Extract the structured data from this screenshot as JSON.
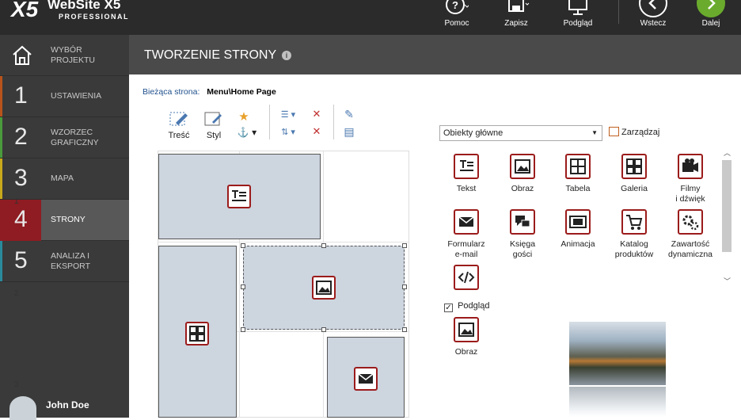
{
  "app": {
    "logo_mark": "X5",
    "name": "WebSite X5",
    "edition": "PROFESSIONAL"
  },
  "toolbar": [
    {
      "label": "Pomoc",
      "icon": "help-icon"
    },
    {
      "label": "Zapisz",
      "icon": "save-icon"
    },
    {
      "label": "Podgląd",
      "icon": "monitor-icon"
    },
    {
      "label": "Wstecz",
      "icon": "back-icon"
    },
    {
      "label": "Dalej",
      "icon": "next-icon"
    }
  ],
  "sidebar": {
    "items": [
      {
        "num": "",
        "label": "WYBÓR PROJEKTU",
        "icon": "home-icon",
        "color": "#3a3a3a"
      },
      {
        "num": "1",
        "label": "USTAWIENIA",
        "color": "#b8541b"
      },
      {
        "num": "2",
        "label": "WZORZEC GRAFICZNY",
        "color": "#4a9a3c"
      },
      {
        "num": "3",
        "label": "MAPA",
        "color": "#c9a91c"
      },
      {
        "num": "4",
        "label": "STRONY",
        "color": "#8e1c22"
      },
      {
        "num": "5",
        "label": "ANALIZA I EKSPORT",
        "color": "#2a8a9c"
      }
    ],
    "active_index": 4,
    "user": "John Doe"
  },
  "header": {
    "title": "TWORZENIE STRONY",
    "info_icon": "info-icon"
  },
  "current_page": {
    "label": "Bieżąca strona:",
    "value": "Menu\\Home Page"
  },
  "edit_tools": {
    "content": "Treść",
    "style": "Styl"
  },
  "grid": {
    "rows": [
      "1",
      "2",
      "3"
    ]
  },
  "objects": {
    "dropdown_value": "Obiekty główne",
    "manage_label": "Zarządzaj",
    "items": [
      {
        "label": "Tekst",
        "icon": "text-icon"
      },
      {
        "label": "Obraz",
        "icon": "image-icon"
      },
      {
        "label": "Tabela",
        "icon": "table-icon"
      },
      {
        "label": "Galeria",
        "icon": "gallery-icon"
      },
      {
        "label": "Filmy\ni dźwięk",
        "icon": "video-icon"
      },
      {
        "label": "Formularz\ne-mail",
        "icon": "email-icon"
      },
      {
        "label": "Księga\ngości",
        "icon": "guestbook-icon"
      },
      {
        "label": "Animacja",
        "icon": "film-icon"
      },
      {
        "label": "Katalog\nproduktów",
        "icon": "cart-icon"
      },
      {
        "label": "Zawartość\ndynamiczna",
        "icon": "gears-icon"
      },
      {
        "label": "",
        "icon": "code-icon"
      }
    ],
    "preview_label": "Podgląd",
    "preview_checked": true,
    "preview_object": "Obraz"
  }
}
